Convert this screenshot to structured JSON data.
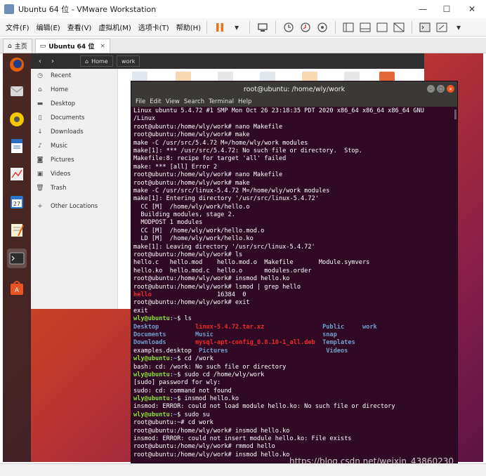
{
  "window": {
    "title": "Ubuntu 64 位 - VMware Workstation",
    "minimize": "—",
    "maximize": "☐",
    "close": "✕"
  },
  "menu": [
    "文件(F)",
    "编辑(E)",
    "查看(V)",
    "虚拟机(M)",
    "选项卡(T)",
    "帮助(H)"
  ],
  "tabs": [
    {
      "label": "主页"
    },
    {
      "label": "Ubuntu 64 位",
      "close": "×"
    }
  ],
  "files": {
    "breadcrumbs": [
      "Home",
      "work"
    ],
    "sidebar": [
      "Recent",
      "Home",
      "Desktop",
      "Documents",
      "Downloads",
      "Music",
      "Pictures",
      "Videos",
      "Trash",
      "Other Locations"
    ]
  },
  "terminal": {
    "title": "root@ubuntu: /home/wly/work",
    "menu": [
      "File",
      "Edit",
      "View",
      "Search",
      "Terminal",
      "Help"
    ],
    "lines": [
      [
        {
          "t": "Linux ubuntu 5.4.72 #1 SMP Mon Oct 26 23:18:35 PDT 2020 x86_64 x86_64 x86_64 GNU"
        }
      ],
      [
        {
          "t": "/Linux"
        }
      ],
      [
        {
          "t": "root@ubuntu:/home/wly/work# nano Makefile"
        }
      ],
      [
        {
          "t": "root@ubuntu:/home/wly/work# make"
        }
      ],
      [
        {
          "t": "make -C /usr/src/5.4.72 M=/home/wly/work modules"
        }
      ],
      [
        {
          "t": "make[1]: *** /usr/src/5.4.72: No such file or directory.  Stop."
        }
      ],
      [
        {
          "t": "Makefile:8: recipe for target 'all' failed"
        }
      ],
      [
        {
          "t": "make: *** [all] Error 2"
        }
      ],
      [
        {
          "t": "root@ubuntu:/home/wly/work# nano Makefile"
        }
      ],
      [
        {
          "t": "root@ubuntu:/home/wly/work# make"
        }
      ],
      [
        {
          "t": "make -C /usr/src/linux-5.4.72 M=/home/wly/work modules"
        }
      ],
      [
        {
          "t": "make[1]: Entering directory '/usr/src/linux-5.4.72'"
        }
      ],
      [
        {
          "t": "  CC [M]  /home/wly/work/hello.o"
        }
      ],
      [
        {
          "t": "  Building modules, stage 2."
        }
      ],
      [
        {
          "t": "  MODPOST 1 modules"
        }
      ],
      [
        {
          "t": "  CC [M]  /home/wly/work/hello.mod.o"
        }
      ],
      [
        {
          "t": "  LD [M]  /home/wly/work/hello.ko"
        }
      ],
      [
        {
          "t": "make[1]: Leaving directory '/usr/src/linux-5.4.72'"
        }
      ],
      [
        {
          "t": "root@ubuntu:/home/wly/work# ls"
        }
      ],
      [
        {
          "t": "hello.c   hello.mod    hello.mod.o  Makefile       Module.symvers"
        }
      ],
      [
        {
          "t": "hello.ko  hello.mod.c  hello.o      modules.order"
        }
      ],
      [
        {
          "t": "root@ubuntu:/home/wly/work# insmod hello.ko"
        }
      ],
      [
        {
          "t": "root@ubuntu:/home/wly/work# lsmod | grep hello"
        }
      ],
      [
        {
          "t": "hello",
          "c": "c-red"
        },
        {
          "t": "                  16384  0"
        }
      ],
      [
        {
          "t": "root@ubuntu:/home/wly/work# exit"
        }
      ],
      [
        {
          "t": "exit"
        }
      ],
      [
        {
          "t": "wly@ubuntu",
          "c": "prompt-g"
        },
        {
          "t": ":"
        },
        {
          "t": "~",
          "c": "prompt-b"
        },
        {
          "t": "$ ls"
        }
      ],
      [
        {
          "t": "Desktop",
          "c": "c-dir"
        },
        {
          "t": "          "
        },
        {
          "t": "linux-5.4.72.tar.xz",
          "c": "c-red"
        },
        {
          "t": "                "
        },
        {
          "t": "Public",
          "c": "c-dir"
        },
        {
          "t": "     "
        },
        {
          "t": "work",
          "c": "c-dir"
        }
      ],
      [
        {
          "t": "Documents",
          "c": "c-dir"
        },
        {
          "t": "        "
        },
        {
          "t": "Music",
          "c": "c-dir"
        },
        {
          "t": "                              "
        },
        {
          "t": "snap",
          "c": "c-dir"
        }
      ],
      [
        {
          "t": "Downloads",
          "c": "c-dir"
        },
        {
          "t": "        "
        },
        {
          "t": "mysql-apt-config_0.8.10-1_all.deb",
          "c": "c-red"
        },
        {
          "t": "  "
        },
        {
          "t": "Templates",
          "c": "c-dir"
        }
      ],
      [
        {
          "t": "examples.desktop  "
        },
        {
          "t": "Pictures",
          "c": "c-dir"
        },
        {
          "t": "                           "
        },
        {
          "t": "Videos",
          "c": "c-dir"
        }
      ],
      [
        {
          "t": "wly@ubuntu",
          "c": "prompt-g"
        },
        {
          "t": ":"
        },
        {
          "t": "~",
          "c": "prompt-b"
        },
        {
          "t": "$ cd /work"
        }
      ],
      [
        {
          "t": "bash: cd: /work: No such file or directory"
        }
      ],
      [
        {
          "t": "wly@ubuntu",
          "c": "prompt-g"
        },
        {
          "t": ":"
        },
        {
          "t": "~",
          "c": "prompt-b"
        },
        {
          "t": "$ sudo cd /home/wly/work"
        }
      ],
      [
        {
          "t": "[sudo] password for wly:"
        }
      ],
      [
        {
          "t": "sudo: cd: command not found"
        }
      ],
      [
        {
          "t": "wly@ubuntu",
          "c": "prompt-g"
        },
        {
          "t": ":"
        },
        {
          "t": "~",
          "c": "prompt-b"
        },
        {
          "t": "$ insmod hello.ko"
        }
      ],
      [
        {
          "t": "insmod: ERROR: could not load module hello.ko: No such file or directory"
        }
      ],
      [
        {
          "t": "wly@ubuntu",
          "c": "prompt-g"
        },
        {
          "t": ":"
        },
        {
          "t": "~",
          "c": "prompt-b"
        },
        {
          "t": "$ sudo su"
        }
      ],
      [
        {
          "t": "root@ubuntu:~# cd work"
        }
      ],
      [
        {
          "t": "root@ubuntu:/home/wly/work# insmod hello.ko"
        }
      ],
      [
        {
          "t": "insmod: ERROR: could not insert module hello.ko: File exists"
        }
      ],
      [
        {
          "t": "root@ubuntu:/home/wly/work# rmmod hello"
        }
      ],
      [
        {
          "t": "root@ubuntu:/home/wly/work# insmod hello.ko"
        }
      ]
    ]
  },
  "watermark": "https://blog.csdn.net/weixin_43860230",
  "colors": {
    "terminal_bg": "#300a24",
    "prompt_green": "#8ae234",
    "dir_blue": "#729fcf",
    "archive_red": "#ef2929",
    "ubuntu_orange": "#e95420"
  }
}
